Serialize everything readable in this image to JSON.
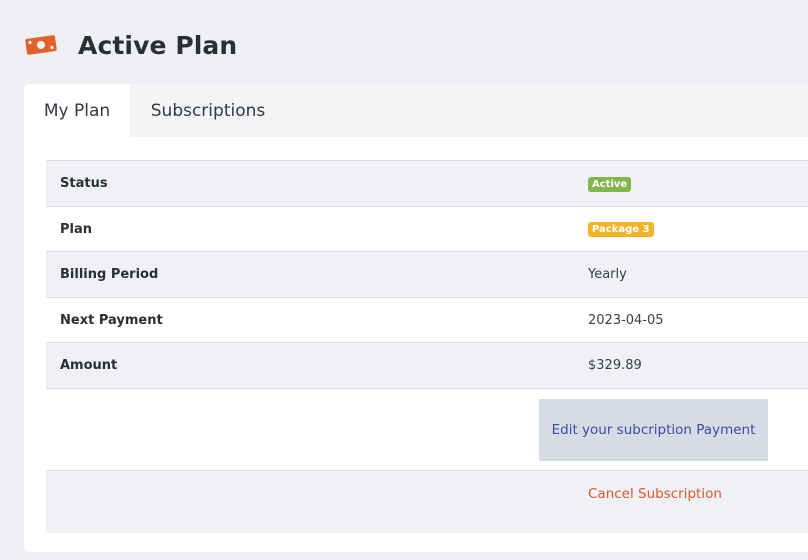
{
  "header": {
    "title": "Active Plan",
    "icon": "money-icon",
    "icon_color": "#e0612a"
  },
  "tabs": [
    {
      "label": "My Plan",
      "active": true
    },
    {
      "label": "Subscriptions",
      "active": false
    }
  ],
  "plan_table": {
    "rows": [
      {
        "label": "Status",
        "value": "Active",
        "kind": "badge",
        "color": "#84b44c"
      },
      {
        "label": "Plan",
        "value": "Package 3",
        "kind": "badge",
        "color": "#f0b42a"
      },
      {
        "label": "Billing Period",
        "value": "Yearly"
      },
      {
        "label": "Next Payment",
        "value": "2023-04-05"
      },
      {
        "label": "Amount",
        "value": "$329.89"
      }
    ]
  },
  "actions": {
    "edit_payment_label": "Edit your subcription Payment",
    "cancel_label": "Cancel Subscription",
    "cancel_color": "#d8582a"
  }
}
